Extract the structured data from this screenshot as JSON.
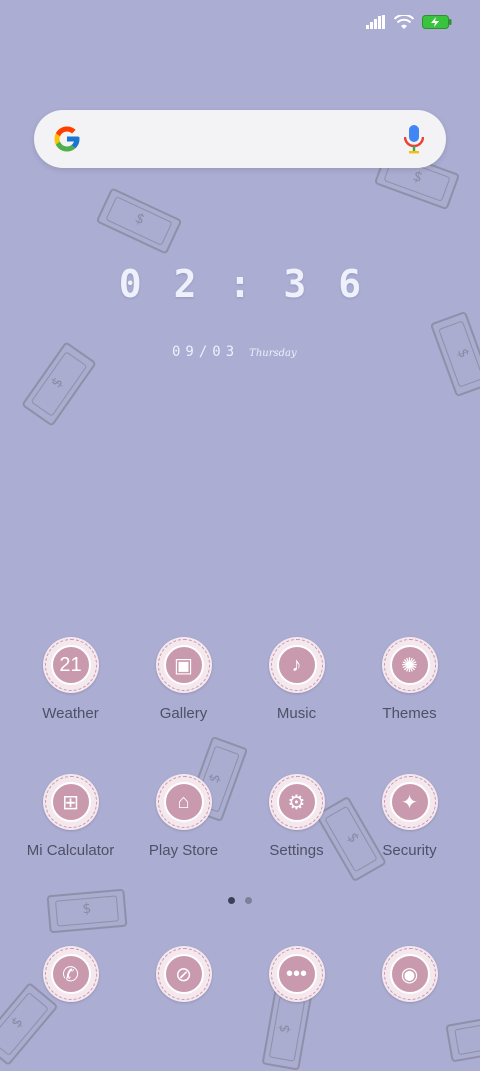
{
  "status_bar": {
    "icons": [
      "signal-icon",
      "wifi-icon",
      "battery-charging-icon"
    ],
    "battery_color": "#39c33f"
  },
  "search": {
    "logo": "G",
    "mic_icon": "mic-icon"
  },
  "clock": {
    "time": "02:36"
  },
  "date": {
    "date": "09/03",
    "day": "Thursday"
  },
  "weather_icon_temp": "21",
  "apps_row1": [
    {
      "label": "Weather",
      "icon": "weather-icon"
    },
    {
      "label": "Gallery",
      "icon": "gallery-icon"
    },
    {
      "label": "Music",
      "icon": "microphone-icon"
    },
    {
      "label": "Themes",
      "icon": "sun-icon"
    }
  ],
  "apps_row2": [
    {
      "label": "Mi Calculator",
      "icon": "calculator-icon"
    },
    {
      "label": "Play Store",
      "icon": "store-icon"
    },
    {
      "label": "Settings",
      "icon": "gear-icon"
    },
    {
      "label": "Security",
      "icon": "lightbulb-icon"
    }
  ],
  "dock": [
    {
      "icon": "phone-icon"
    },
    {
      "icon": "browser-icon"
    },
    {
      "icon": "messages-icon"
    },
    {
      "icon": "camera-icon"
    }
  ],
  "page_indicator": {
    "pages": 2,
    "current": 1
  },
  "colors": {
    "wallpaper": "#acadd3",
    "icon_accent": "#c99aae"
  }
}
